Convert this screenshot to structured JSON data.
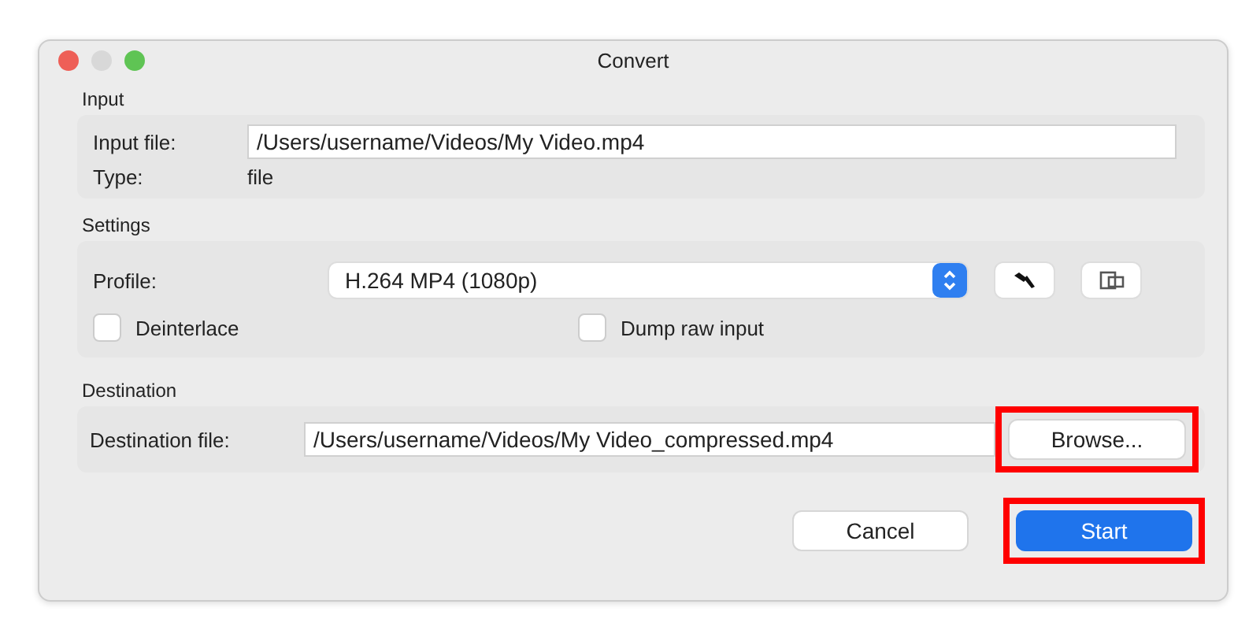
{
  "window": {
    "title": "Convert"
  },
  "input": {
    "title": "Input",
    "file_label": "Input file:",
    "file_value": "/Users/username/Videos/My Video.mp4",
    "type_label": "Type:",
    "type_value": "file"
  },
  "settings": {
    "title": "Settings",
    "profile_label": "Profile:",
    "profile_value": "H.264 MP4 (1080p)",
    "checkboxes": [
      {
        "label": "Deinterlace",
        "checked": false
      },
      {
        "label": "Dump raw input",
        "checked": false
      }
    ]
  },
  "destination": {
    "title": "Destination",
    "file_label": "Destination file:",
    "file_value": "/Users/username/Videos/My Video_compressed.mp4",
    "browse": {
      "label": "Browse...",
      "highlighted": true
    }
  },
  "buttons": [
    {
      "label": "Cancel",
      "kind": "default",
      "highlighted": false
    },
    {
      "label": "Start",
      "kind": "primary",
      "highlighted": true
    }
  ]
}
